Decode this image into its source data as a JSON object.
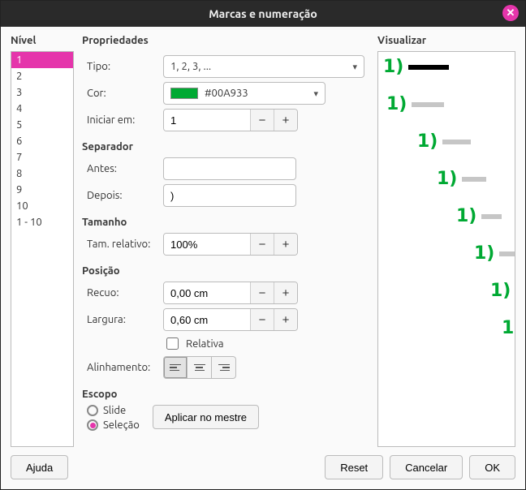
{
  "title": "Marcas e numeração",
  "level": {
    "heading": "Nível",
    "items": [
      "1",
      "2",
      "3",
      "4",
      "5",
      "6",
      "7",
      "8",
      "9",
      "10",
      "1 - 10"
    ],
    "selected": 0
  },
  "props": {
    "heading": "Propriedades",
    "type_label": "Tipo:",
    "type_value": "1, 2, 3, ...",
    "color_label": "Cor:",
    "color_value": "#00A933",
    "start_label": "Iniciar em:",
    "start_value": "1",
    "sep_heading": "Separador",
    "before_label": "Antes:",
    "before_value": "",
    "after_label": "Depois:",
    "after_value": ")",
    "size_heading": "Tamanho",
    "relsize_label": "Tam. relativo:",
    "relsize_value": "100%",
    "pos_heading": "Posição",
    "indent_label": "Recuo:",
    "indent_value": "0,00 cm",
    "width_label": "Largura:",
    "width_value": "0,60 cm",
    "relative_label": "Relativa",
    "align_label": "Alinhamento:",
    "scope_heading": "Escopo",
    "scope_slide": "Slide",
    "scope_selection": "Seleção",
    "apply_master": "Aplicar no mestre"
  },
  "preview": {
    "heading": "Visualizar",
    "marker": "1)"
  },
  "footer": {
    "help": "Ajuda",
    "reset": "Reset",
    "cancel": "Cancelar",
    "ok": "OK"
  }
}
